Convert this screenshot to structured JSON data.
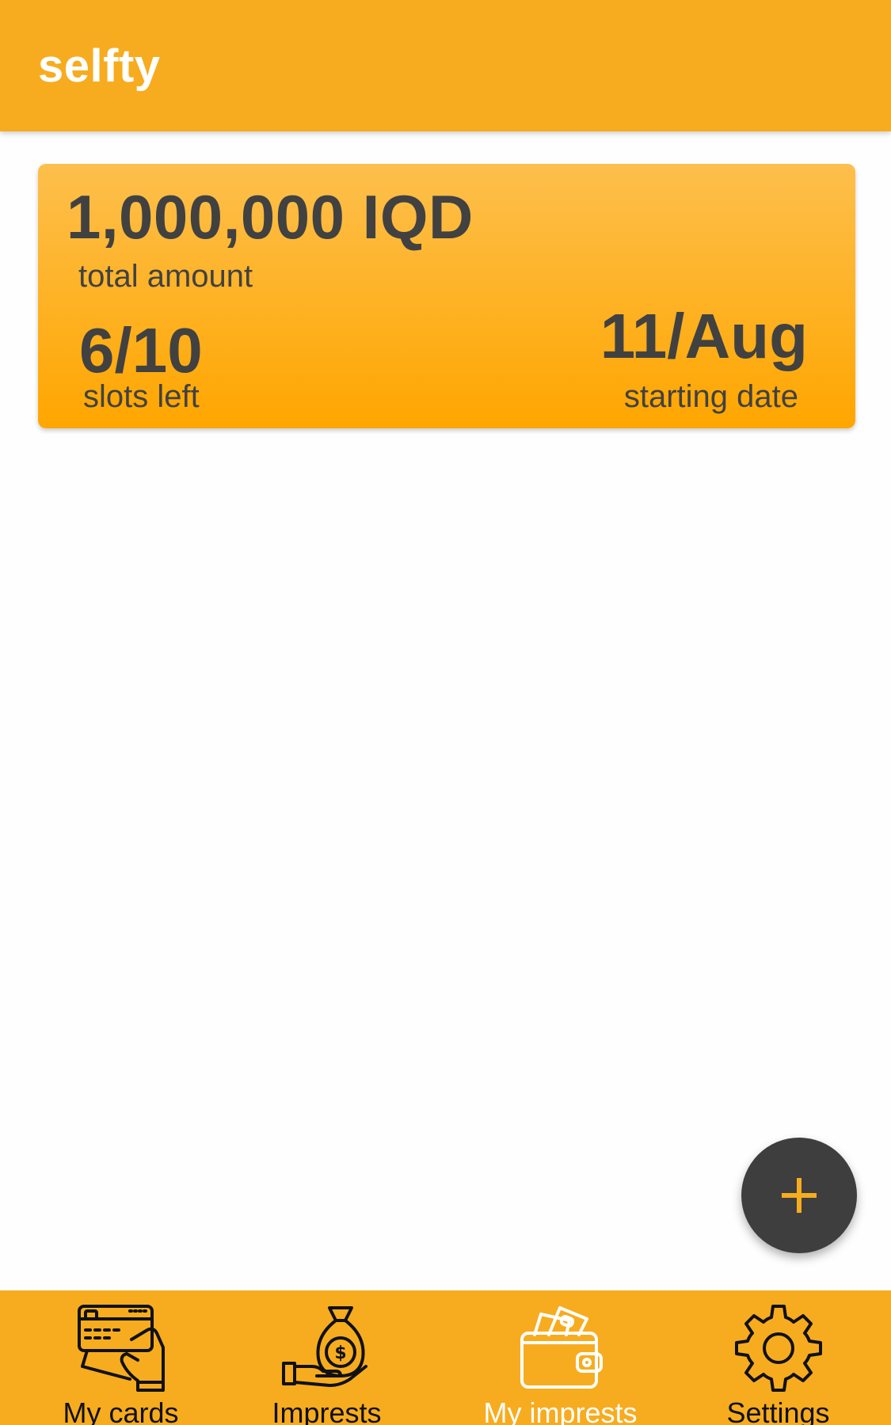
{
  "app_bar": {
    "title": "selfty"
  },
  "imprest_card": {
    "amount": "1,000,000 IQD",
    "amount_label": "total amount",
    "slots": "6/10",
    "slots_label": "slots left",
    "start_date": "11/Aug",
    "start_date_label": "starting date"
  },
  "fab": {
    "icon": "plus-icon"
  },
  "bottom_nav": {
    "items": [
      {
        "label": "My cards",
        "icon": "credit-card-hand-icon",
        "active": false
      },
      {
        "label": "Imprests",
        "icon": "money-bag-hand-icon",
        "active": false
      },
      {
        "label": "My imprests",
        "icon": "wallet-icon",
        "active": true
      },
      {
        "label": "Settings",
        "icon": "gear-icon",
        "active": false
      }
    ]
  },
  "colors": {
    "primary": "#f7ac1f",
    "card_top": "#fdbf4c",
    "card_bottom": "#ffa600",
    "text_dark": "#414141",
    "fab_background": "#3e3e3e",
    "fab_icon": "#f7ac1f",
    "active_nav": "#ffffff"
  }
}
